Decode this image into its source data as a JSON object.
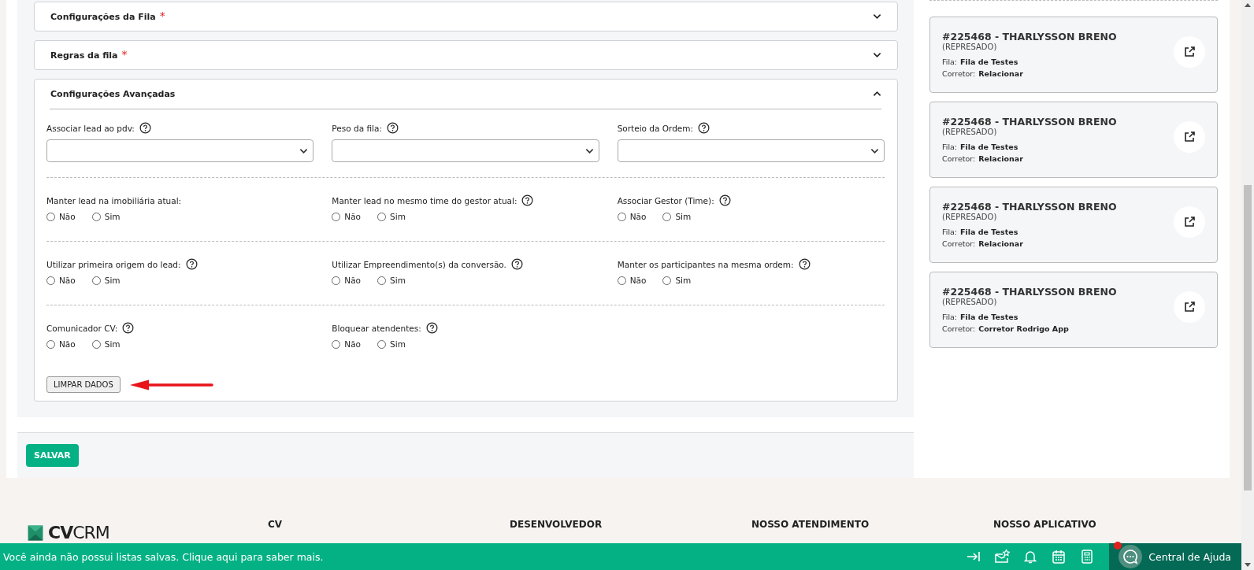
{
  "sections": [
    {
      "title": "Configurações da Fila",
      "required_mark": "*",
      "expanded": false
    },
    {
      "title": "Regras da fila",
      "required_mark": "*",
      "expanded": false
    },
    {
      "title": "Configurações Avançadas",
      "expanded": true
    }
  ],
  "advanced": {
    "rows": [
      [
        {
          "kind": "select",
          "label": "Associar lead ao pdv:",
          "help": true
        },
        {
          "kind": "select",
          "label": "Peso da fila:",
          "help": true
        },
        {
          "kind": "select",
          "label": "Sorteio da Ordem:",
          "help": true
        }
      ],
      [
        {
          "kind": "radio",
          "label": "Manter lead na imobiliária atual:",
          "help": false,
          "options": [
            {
              "label": "Não",
              "selected": false
            },
            {
              "label": "Sim",
              "selected": false
            }
          ]
        },
        {
          "kind": "radio",
          "label": "Manter lead no mesmo time do gestor atual:",
          "help": true,
          "options": [
            {
              "label": "Não",
              "selected": false
            },
            {
              "label": "Sim",
              "selected": false
            }
          ]
        },
        {
          "kind": "radio",
          "label": "Associar Gestor (Time):",
          "help": true,
          "options": [
            {
              "label": "Não",
              "selected": false
            },
            {
              "label": "Sim",
              "selected": false
            }
          ]
        }
      ],
      [
        {
          "kind": "radio",
          "label": "Utilizar primeira origem do lead:",
          "help": true,
          "options": [
            {
              "label": "Não",
              "selected": false
            },
            {
              "label": "Sim",
              "selected": false
            }
          ]
        },
        {
          "kind": "radio",
          "label": "Utilizar Empreendimento(s) da conversão.",
          "help": true,
          "options": [
            {
              "label": "Não",
              "selected": false
            },
            {
              "label": "Sim",
              "selected": false
            }
          ]
        },
        {
          "kind": "radio",
          "label": "Manter os participantes na mesma ordem:",
          "help": true,
          "options": [
            {
              "label": "Não",
              "selected": false
            },
            {
              "label": "Sim",
              "selected": false
            }
          ]
        }
      ],
      [
        {
          "kind": "radio",
          "label": "Comunicador CV:",
          "help": true,
          "options": [
            {
              "label": "Não",
              "selected": false
            },
            {
              "label": "Sim",
              "selected": false
            }
          ]
        },
        {
          "kind": "radio",
          "label": "Bloquear atendentes:",
          "help": true,
          "options": [
            {
              "label": "Não",
              "selected": false
            },
            {
              "label": "Sim",
              "selected": false
            }
          ]
        }
      ]
    ],
    "clear_button": "LIMPAR DADOS"
  },
  "save_button": "SALVAR",
  "cards": [
    {
      "title": "#225468 - THARLYSSON BRENO",
      "status": "(REPRESADO)",
      "queue_label": "Fila:",
      "queue": "Fila de Testes",
      "broker_label": "Corretor:",
      "broker": "Relacionar"
    },
    {
      "title": "#225468 - THARLYSSON BRENO",
      "status": "(REPRESADO)",
      "queue_label": "Fila:",
      "queue": "Fila de Testes",
      "broker_label": "Corretor:",
      "broker": "Relacionar"
    },
    {
      "title": "#225468 - THARLYSSON BRENO",
      "status": "(REPRESADO)",
      "queue_label": "Fila:",
      "queue": "Fila de Testes",
      "broker_label": "Corretor:",
      "broker": "Relacionar"
    },
    {
      "title": "#225468 - THARLYSSON BRENO",
      "status": "(REPRESADO)",
      "queue_label": "Fila:",
      "queue": "Fila de Testes",
      "broker_label": "Corretor:",
      "broker": "Corretor Rodrigo App"
    }
  ],
  "footer": {
    "logo": {
      "bold": "CV",
      "light": "CRM"
    },
    "headings": [
      "CV",
      "DESENVOLVEDOR",
      "NOSSO ATENDIMENTO",
      "NOSSO APLICATIVO"
    ]
  },
  "bottom_bar": {
    "message": "Você ainda não possui listas salvas. Clique aqui para saber mais.",
    "help_label": "Central de Ajuda",
    "help_notification": true
  }
}
